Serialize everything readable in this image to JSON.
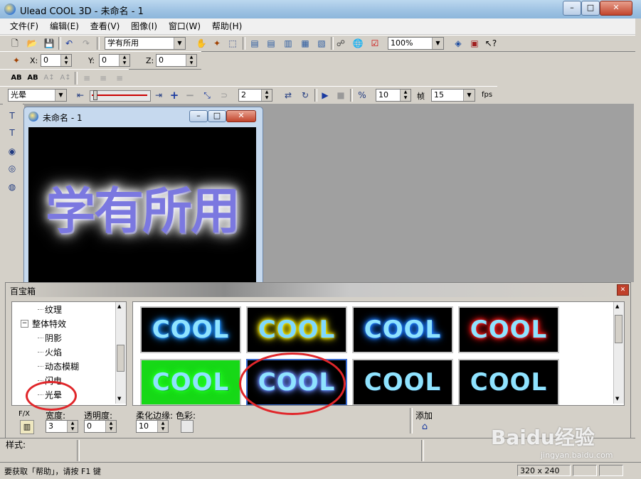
{
  "window": {
    "title": "Ulead COOL 3D - 未命名 - 1",
    "min": "–",
    "max": "□",
    "close": "✕"
  },
  "menu": [
    "文件(F)",
    "编辑(E)",
    "查看(V)",
    "图像(I)",
    "窗口(W)",
    "帮助(H)"
  ],
  "toolbar1": {
    "text_combo": "学有所用",
    "zoom": "100%"
  },
  "toolbar2": {
    "x_label": "X:",
    "x_value": "0",
    "y_label": "Y:",
    "y_value": "0",
    "z_label": "Z:",
    "z_value": "0"
  },
  "toolbar4": {
    "effect_combo": "光晕",
    "frame_value": "2",
    "speed_value": "10",
    "frame_label": "帧",
    "fps_value": "15",
    "fps_label": "fps"
  },
  "child": {
    "title": "未命名 - 1",
    "canvas_text": "学有所用",
    "min": "–",
    "max": "□",
    "close": "✕"
  },
  "panel": {
    "title": "百宝箱",
    "close": "✕",
    "tree": [
      {
        "label": "纹理",
        "indent": 2
      },
      {
        "label": "整体特效",
        "indent": 1,
        "toggle": "−"
      },
      {
        "label": "阴影",
        "indent": 2
      },
      {
        "label": "火焰",
        "indent": 2
      },
      {
        "label": "动态模糊",
        "indent": 2
      },
      {
        "label": "闪电",
        "indent": 2
      },
      {
        "label": "光晕",
        "indent": 2
      }
    ],
    "thumbs": [
      {
        "text": "COOL",
        "color": "#8fe3ff",
        "glow": "#1e90ff",
        "bg": "#000000"
      },
      {
        "text": "COOL",
        "color": "#7fd8ff",
        "glow": "#ffee00",
        "bg": "#000000"
      },
      {
        "text": "COOL",
        "color": "#8fe3ff",
        "glow": "#1e7bff",
        "bg": "#000000"
      },
      {
        "text": "COOL",
        "color": "#8fe3ff",
        "glow": "#ff1a1a",
        "bg": "#000000"
      },
      {
        "text": "COOL",
        "color": "#8fe3ff",
        "glow": "#22ff22",
        "bg": "#17d817"
      },
      {
        "text": "COOL",
        "color": "#8fe3ff",
        "glow": "#6a8aff",
        "bg": "#000000"
      },
      {
        "text": "COOL",
        "color": "#8fe3ff",
        "glow": "#000000",
        "bg": "#000000"
      },
      {
        "text": "COOL",
        "color": "#8fe3ff",
        "glow": "#000000",
        "bg": "#000000"
      }
    ],
    "fx_label": "F/X",
    "width_label": "宽度:",
    "width_value": "3",
    "opacity_label": "透明度:",
    "opacity_value": "0",
    "soft_label": "柔化边缘:",
    "soft_value": "10",
    "color_label": "色彩:",
    "add_label": "添加"
  },
  "style_label": "样式:",
  "status": {
    "help": "要获取「帮助」，请按 F1 键",
    "size": "320 x 240"
  },
  "watermark": {
    "text": "Baidu经验",
    "url": "jingyan.baidu.com"
  }
}
